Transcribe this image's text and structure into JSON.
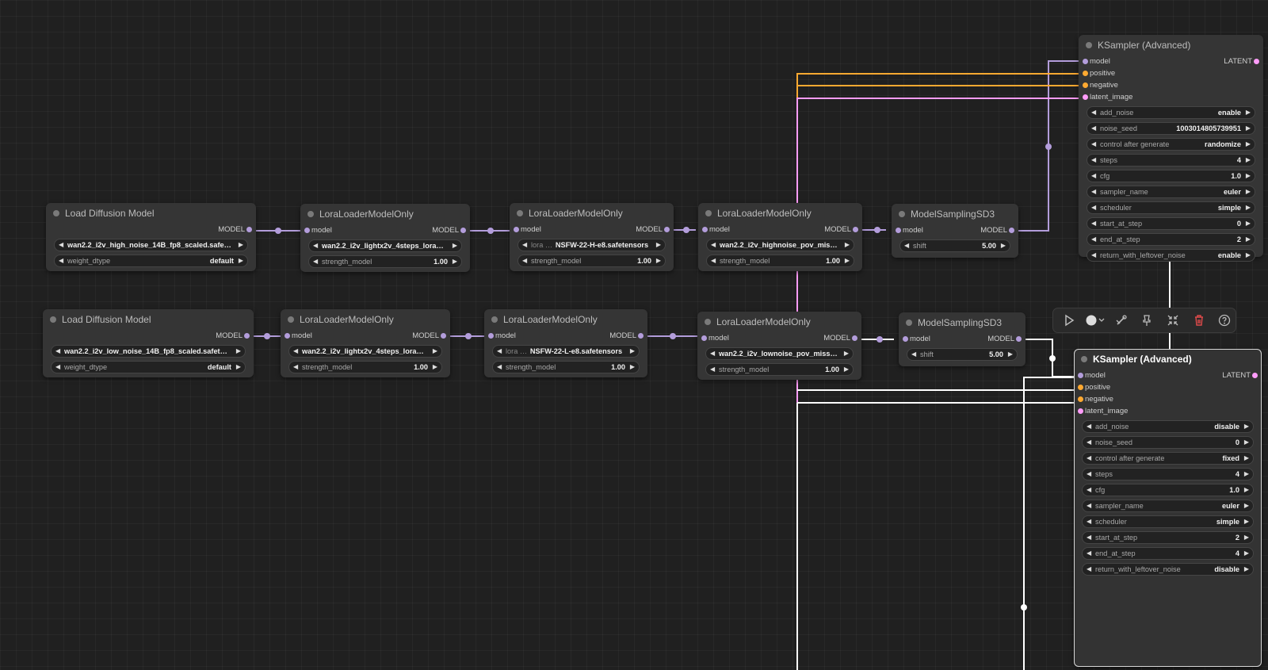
{
  "nodes": {
    "load_high": {
      "title": "Load Diffusion Model",
      "out": "MODEL",
      "unet_name": "wan2.2_i2v_high_noise_14B_fp8_scaled.safet …",
      "weight_dtype_label": "weight_dtype",
      "weight_dtype": "default"
    },
    "lora_high_1": {
      "title": "LoraLoaderModelOnly",
      "in": "model",
      "out": "MODEL",
      "lora_name": "wan2.2_i2v_lightx2v_4steps_lora_…",
      "strength_label": "strength_model",
      "strength": "1.00"
    },
    "lora_high_2": {
      "title": "LoraLoaderModelOnly",
      "in": "model",
      "out": "MODEL",
      "lora_label": "lora …",
      "lora_name": "NSFW-22-H-e8.safetensors",
      "strength_label": "strength_model",
      "strength": "1.00"
    },
    "lora_high_3": {
      "title": "LoraLoaderModelOnly",
      "in": "model",
      "out": "MODEL",
      "lora_name": "wan2.2_i2v_highnoise_pov_mis …",
      "strength_label": "strength_model",
      "strength": "1.00"
    },
    "msd3_high": {
      "title": "ModelSamplingSD3",
      "in": "model",
      "out": "MODEL",
      "shift_label": "shift",
      "shift": "5.00"
    },
    "load_low": {
      "title": "Load Diffusion Model",
      "out": "MODEL",
      "unet_name": "wan2.2_i2v_low_noise_14B_fp8_scaled.safete …",
      "weight_dtype_label": "weight_dtype",
      "weight_dtype": "default"
    },
    "lora_low_1": {
      "title": "LoraLoaderModelOnly",
      "in": "model",
      "out": "MODEL",
      "lora_name": "wan2.2_i2v_lightx2v_4steps_lora_…",
      "strength_label": "strength_model",
      "strength": "1.00"
    },
    "lora_low_2": {
      "title": "LoraLoaderModelOnly",
      "in": "model",
      "out": "MODEL",
      "lora_label": "lora …",
      "lora_name": "NSFW-22-L-e8.safetensors",
      "strength_label": "strength_model",
      "strength": "1.00"
    },
    "lora_low_3": {
      "title": "LoraLoaderModelOnly",
      "in": "model",
      "out": "MODEL",
      "lora_name": "wan2.2_i2v_lownoise_pov_missi …",
      "strength_label": "strength_model",
      "strength": "1.00"
    },
    "msd3_low": {
      "title": "ModelSamplingSD3",
      "in": "model",
      "out": "MODEL",
      "shift_label": "shift",
      "shift": "5.00"
    },
    "ks1": {
      "title": "KSampler (Advanced)",
      "inputs": [
        "model",
        "positive",
        "negative",
        "latent_image"
      ],
      "out": "LATENT",
      "widgets": [
        {
          "label": "add_noise",
          "value": "enable"
        },
        {
          "label": "noise_seed",
          "value": "1003014805739951"
        },
        {
          "label": "control after generate",
          "value": "randomize"
        },
        {
          "label": "steps",
          "value": "4"
        },
        {
          "label": "cfg",
          "value": "1.0"
        },
        {
          "label": "sampler_name",
          "value": "euler"
        },
        {
          "label": "scheduler",
          "value": "simple"
        },
        {
          "label": "start_at_step",
          "value": "0"
        },
        {
          "label": "end_at_step",
          "value": "2"
        },
        {
          "label": "return_with_leftover_noise",
          "value": "enable"
        }
      ]
    },
    "ks2": {
      "title": "KSampler (Advanced)",
      "inputs": [
        "model",
        "positive",
        "negative",
        "latent_image"
      ],
      "out": "LATENT",
      "widgets": [
        {
          "label": "add_noise",
          "value": "disable"
        },
        {
          "label": "noise_seed",
          "value": "0"
        },
        {
          "label": "control after generate",
          "value": "fixed"
        },
        {
          "label": "steps",
          "value": "4"
        },
        {
          "label": "cfg",
          "value": "1.0"
        },
        {
          "label": "sampler_name",
          "value": "euler"
        },
        {
          "label": "scheduler",
          "value": "simple"
        },
        {
          "label": "start_at_step",
          "value": "2"
        },
        {
          "label": "end_at_step",
          "value": "4"
        },
        {
          "label": "return_with_leftover_noise",
          "value": "disable"
        }
      ]
    }
  },
  "toolbar": {
    "icons": [
      "play-icon",
      "color-circle-icon",
      "bypass-icon",
      "pin-icon",
      "collapse-icon",
      "delete-icon",
      "help-icon"
    ]
  },
  "colors": {
    "model": "#b39ddb",
    "conditioning": "#ffa931",
    "latent": "#ff9cf9",
    "selected_link": "#ffffff",
    "canvas": "#202020"
  }
}
